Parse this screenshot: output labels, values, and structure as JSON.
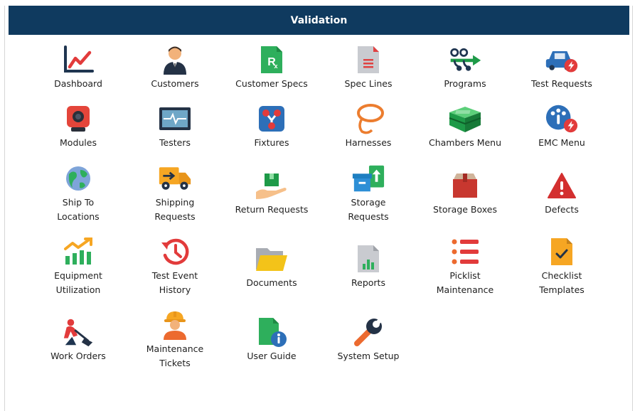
{
  "header": {
    "title": "Validation"
  },
  "tiles": [
    {
      "label": "Dashboard",
      "icon": "dashboard-chart-icon"
    },
    {
      "label": "Customers",
      "icon": "customer-person-icon"
    },
    {
      "label": "Customer Specs",
      "icon": "rx-document-icon"
    },
    {
      "label": "Spec Lines",
      "icon": "document-lines-icon"
    },
    {
      "label": "Programs",
      "icon": "program-flow-icon"
    },
    {
      "label": "Test Requests",
      "icon": "car-test-icon"
    },
    {
      "label": "Modules",
      "icon": "module-camera-icon"
    },
    {
      "label": "Testers",
      "icon": "tester-monitor-icon"
    },
    {
      "label": "Fixtures",
      "icon": "fixture-nodes-icon"
    },
    {
      "label": "Harnesses",
      "icon": "harness-lasso-icon"
    },
    {
      "label": "Chambers Menu",
      "icon": "chamber-box-icon"
    },
    {
      "label": "EMC Menu",
      "icon": "emc-gauge-icon"
    },
    {
      "label": "Ship To\nLocations",
      "icon": "globe-icon"
    },
    {
      "label": "Shipping\nRequests",
      "icon": "truck-icon"
    },
    {
      "label": "Return Requests",
      "icon": "hand-box-icon"
    },
    {
      "label": "Storage\nRequests",
      "icon": "storage-box-upload-icon"
    },
    {
      "label": "Storage Boxes",
      "icon": "storage-box-icon"
    },
    {
      "label": "Defects",
      "icon": "warning-triangle-icon"
    },
    {
      "label": "Equipment\nUtilization",
      "icon": "utilization-bars-icon"
    },
    {
      "label": "Test Event\nHistory",
      "icon": "history-clock-icon"
    },
    {
      "label": "Documents",
      "icon": "folder-icon"
    },
    {
      "label": "Reports",
      "icon": "report-document-icon"
    },
    {
      "label": "Picklist\nMaintenance",
      "icon": "picklist-icon"
    },
    {
      "label": "Checklist\nTemplates",
      "icon": "checklist-document-icon"
    },
    {
      "label": "Work Orders",
      "icon": "worker-shovel-icon"
    },
    {
      "label": "Maintenance\nTickets",
      "icon": "hardhat-worker-icon"
    },
    {
      "label": "User Guide",
      "icon": "info-document-icon"
    },
    {
      "label": "System Setup",
      "icon": "wrench-icon"
    }
  ]
}
